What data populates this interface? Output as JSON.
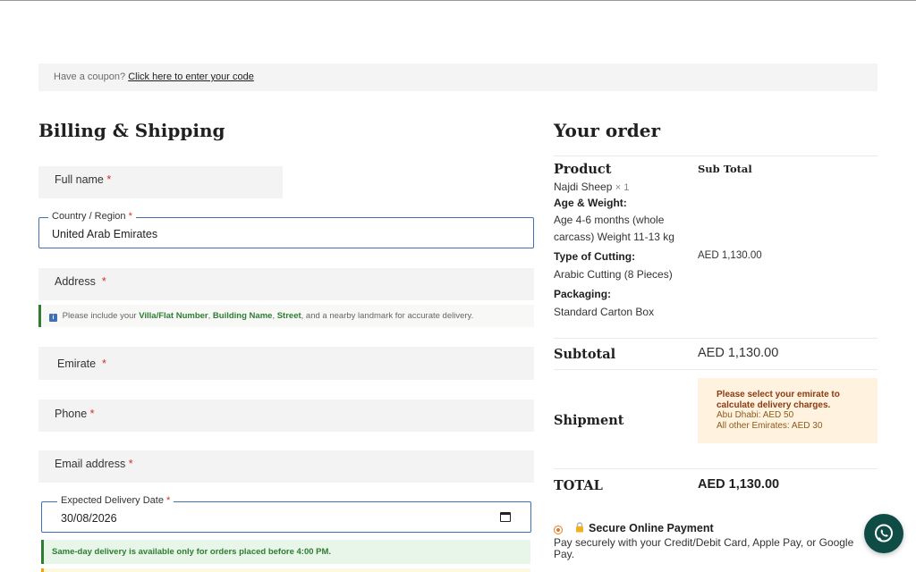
{
  "coupon": {
    "prefix": "Have a coupon?",
    "link": "Click here to enter your code"
  },
  "billing": {
    "title": "Billing & Shipping",
    "full_name_label": "Full name",
    "required_mark": "*",
    "country_label": "Country / Region",
    "country_value": "United Arab Emirates",
    "address_label": "Address",
    "address_hint": {
      "prefix": "Please include your",
      "villa": "Villa/Flat Number",
      "sep1": ",",
      "building": "Building Name",
      "sep2": ",",
      "street": "Street",
      "suffix": ", and a nearby landmark for accurate delivery."
    },
    "emirate_label": "Emirate",
    "phone_label": "Phone",
    "email_label": "Email address",
    "delivery_date_label": "Expected Delivery Date",
    "delivery_date_value": "30/08/2026",
    "sameday_note": "Same-day delivery is available only for orders placed before 4:00 PM."
  },
  "order": {
    "title": "Your order",
    "col_product": "Product",
    "col_subtotal": "Sub Total",
    "product_name": "Najdi Sheep",
    "product_qty": "× 1",
    "age_label": "Age & Weight:",
    "age_value_1": "Age 4-6 months (whole",
    "age_value_2": "carcass) Weight 11-13 kg",
    "cutting_label": "Type of Cutting:",
    "cutting_value": "Arabic Cutting (8 Pieces)",
    "packaging_label": "Packaging:",
    "packaging_value": "Standard Carton Box",
    "line_price": "AED 1,130.00",
    "subtotal_label": "Subtotal",
    "subtotal_value": "AED 1,130.00",
    "shipment_label": "Shipment",
    "shipment_notice_1": "Please select your emirate to",
    "shipment_notice_2": "calculate delivery charges.",
    "shipment_rate_1": "Abu Dhabi: AED 50",
    "shipment_rate_2": "All other Emirates: AED 30",
    "total_label": "TOTAL",
    "total_value": "AED 1,130.00"
  },
  "payment": {
    "title": "Secure Online Payment",
    "description": "Pay securely with your Credit/Debit Card, Apple Pay, or Google Pay."
  },
  "colors": {
    "accent_blue": "#3f6fb5",
    "success_green": "#2e7d32",
    "notice_bg": "#fff3e0",
    "whatsapp_bg": "#0f4c46"
  },
  "icons": [
    "info-icon",
    "calendar-icon",
    "lock-icon",
    "whatsapp-icon"
  ]
}
